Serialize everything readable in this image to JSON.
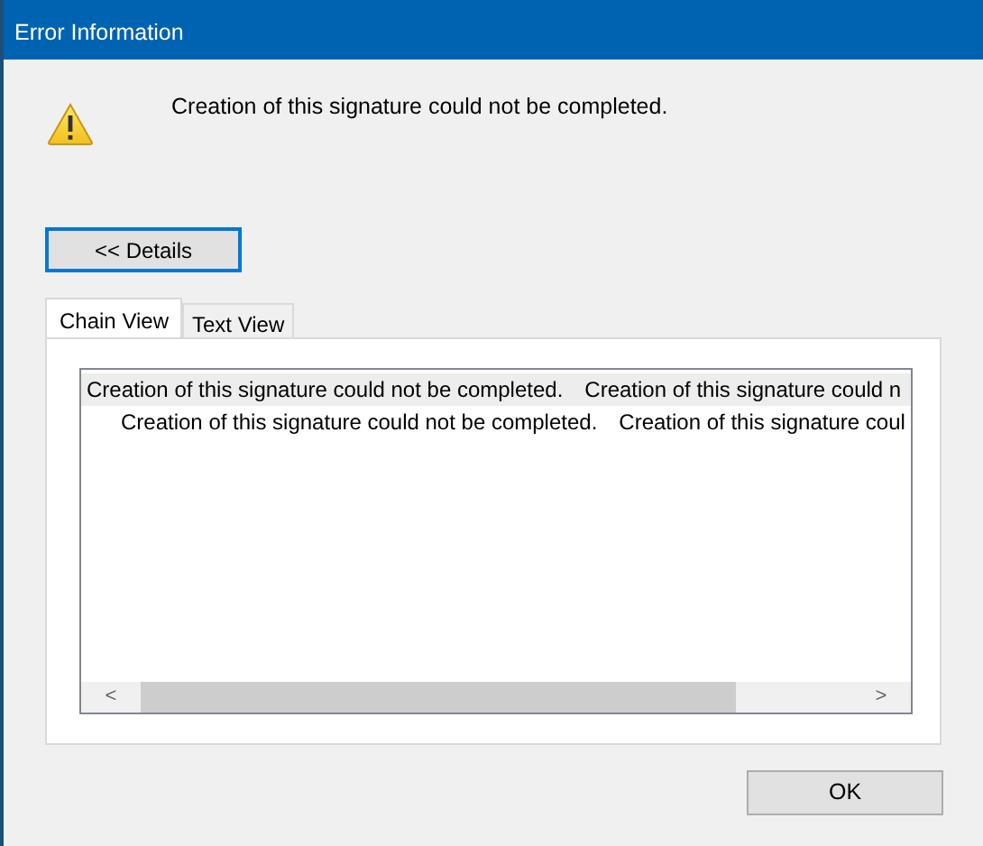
{
  "window": {
    "title": "Error Information"
  },
  "message": "Creation of this signature could not be completed.",
  "details_button": "<< Details",
  "tabs": [
    {
      "label": "Chain View",
      "selected": true
    },
    {
      "label": "Text View",
      "selected": false
    }
  ],
  "tree": [
    {
      "label": "Creation of this signature could not be completed.",
      "detail": "Creation of this signature could n",
      "selected": true,
      "children": [
        {
          "label": "Creation of this signature could not be completed.",
          "detail": "Creation of this signature coul",
          "selected": false
        }
      ]
    }
  ],
  "scroll_left": "<",
  "scroll_right": ">",
  "ok_button": "OK"
}
